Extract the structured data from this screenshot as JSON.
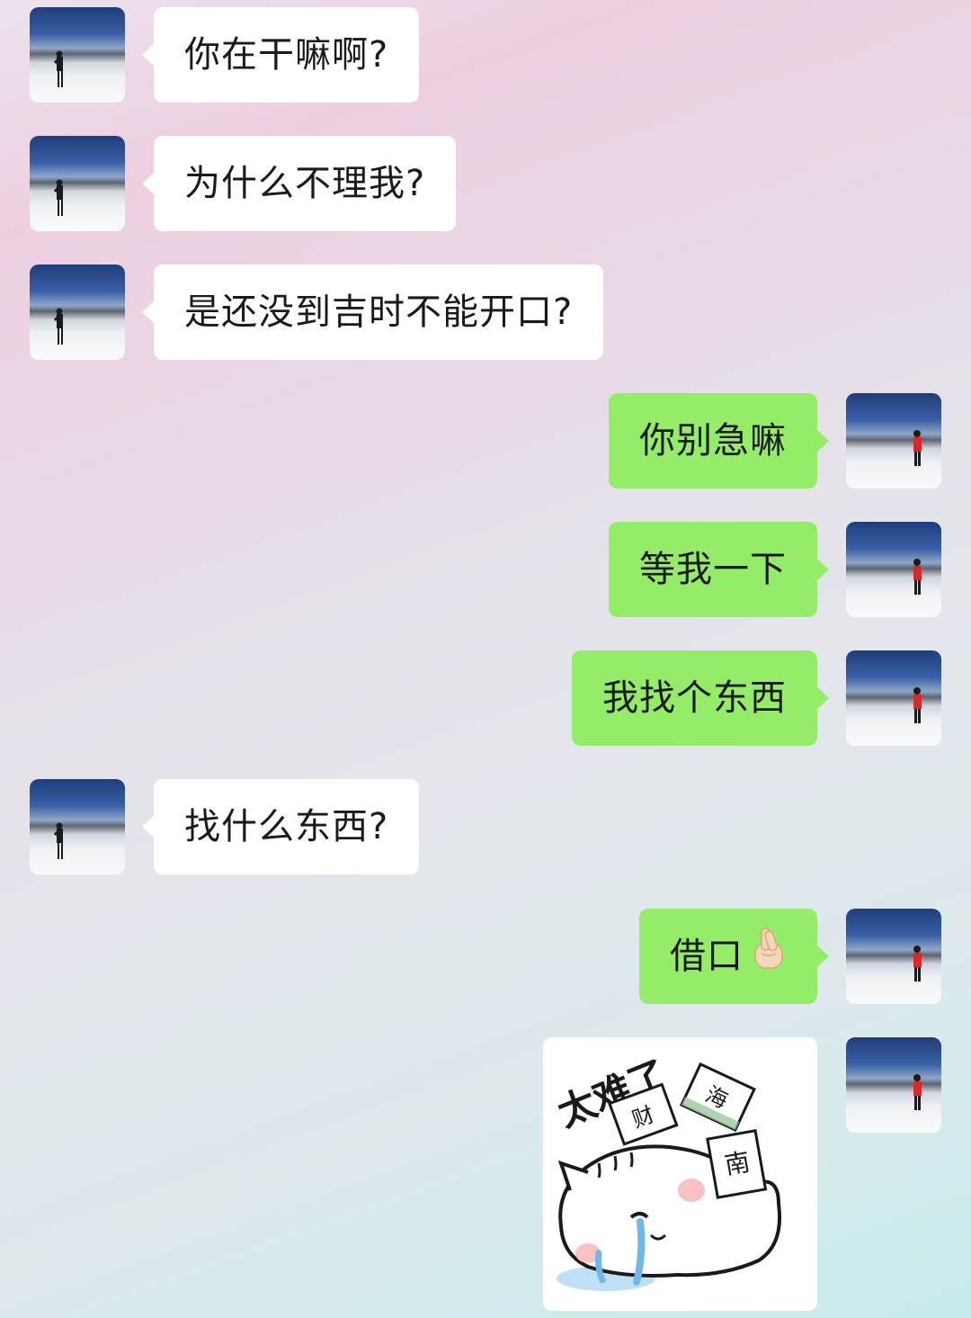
{
  "chat": {
    "messages": [
      {
        "side": "left",
        "text": "你在干嘛啊?"
      },
      {
        "side": "left",
        "text": "为什么不理我?"
      },
      {
        "side": "left",
        "text": "是还没到吉时不能开口?"
      },
      {
        "side": "right",
        "text": "你别急嘛"
      },
      {
        "side": "right",
        "text": "等我一下"
      },
      {
        "side": "right",
        "text": "我找个东西"
      },
      {
        "side": "left",
        "text": "找什么东西?"
      },
      {
        "side": "right",
        "text": "借口",
        "emoji": "crossed-fingers-icon"
      },
      {
        "side": "right",
        "type": "sticker"
      }
    ],
    "sticker": {
      "caption": "太难了",
      "box_labels": [
        "财",
        "海",
        "南"
      ],
      "icon": "crying-cat-sticker"
    }
  }
}
